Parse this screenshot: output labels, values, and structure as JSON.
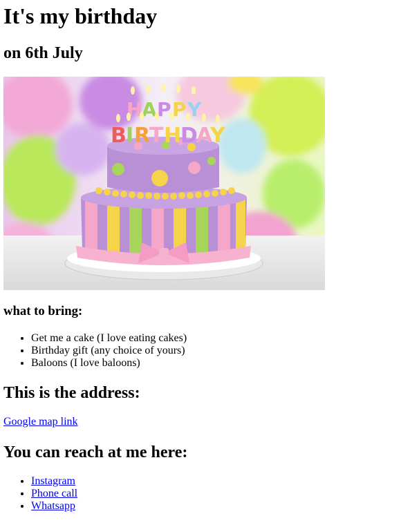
{
  "title": "It's my birthday",
  "date_heading": "on 6th July",
  "cake_image": {
    "candle_letters": "HAPPY BIRTHDAY",
    "colors": {
      "cake_purple": "#b98fd6",
      "stripe_yellow": "#f5d34a",
      "stripe_green": "#a8d65a",
      "stripe_pink": "#f4a7c8",
      "ribbon_pink": "#f7b2cf",
      "dot_green": "#9fd25a"
    }
  },
  "bring": {
    "heading": "what to bring:",
    "items": [
      "Get me a cake (I love eating cakes)",
      "Birthday gift (any choice of yours)",
      "Baloons (I love baloons)"
    ]
  },
  "address": {
    "heading": "This is the address:",
    "link_label": "Google map link"
  },
  "reach": {
    "heading": "You can reach at me here:",
    "links": [
      "Instagram",
      "Phone call",
      "Whatsapp"
    ]
  },
  "link_color": "#0000ee"
}
